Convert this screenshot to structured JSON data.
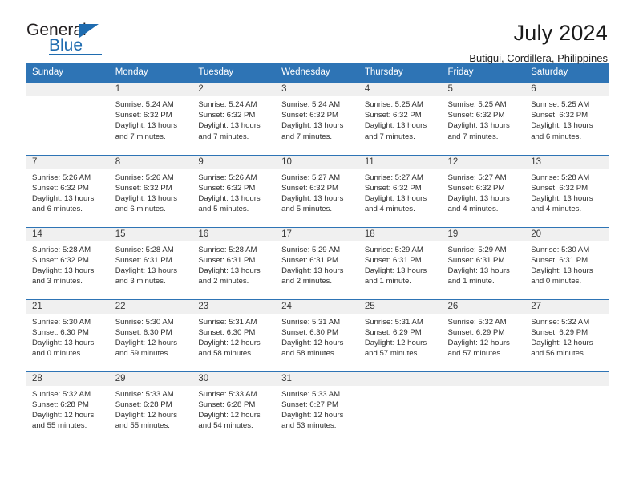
{
  "brand": {
    "name_top": "General",
    "name_bottom": "Blue",
    "accent_color": "#1f6cb0",
    "triangle_icon": "blue-triangle-icon"
  },
  "header": {
    "title": "July 2024",
    "subtitle": "Butigui, Cordillera, Philippines"
  },
  "calendar": {
    "header_bg": "#2e74b5",
    "daynum_bg": "#f0f0f0",
    "weekday_headers": [
      "Sunday",
      "Monday",
      "Tuesday",
      "Wednesday",
      "Thursday",
      "Friday",
      "Saturday"
    ],
    "weeks": [
      [
        {
          "day": "",
          "empty": true,
          "sunrise": "",
          "sunset": "",
          "daylight_line1": "",
          "daylight_line2": ""
        },
        {
          "day": "1",
          "sunrise": "Sunrise: 5:24 AM",
          "sunset": "Sunset: 6:32 PM",
          "daylight_line1": "Daylight: 13 hours",
          "daylight_line2": "and 7 minutes."
        },
        {
          "day": "2",
          "sunrise": "Sunrise: 5:24 AM",
          "sunset": "Sunset: 6:32 PM",
          "daylight_line1": "Daylight: 13 hours",
          "daylight_line2": "and 7 minutes."
        },
        {
          "day": "3",
          "sunrise": "Sunrise: 5:24 AM",
          "sunset": "Sunset: 6:32 PM",
          "daylight_line1": "Daylight: 13 hours",
          "daylight_line2": "and 7 minutes."
        },
        {
          "day": "4",
          "sunrise": "Sunrise: 5:25 AM",
          "sunset": "Sunset: 6:32 PM",
          "daylight_line1": "Daylight: 13 hours",
          "daylight_line2": "and 7 minutes."
        },
        {
          "day": "5",
          "sunrise": "Sunrise: 5:25 AM",
          "sunset": "Sunset: 6:32 PM",
          "daylight_line1": "Daylight: 13 hours",
          "daylight_line2": "and 7 minutes."
        },
        {
          "day": "6",
          "sunrise": "Sunrise: 5:25 AM",
          "sunset": "Sunset: 6:32 PM",
          "daylight_line1": "Daylight: 13 hours",
          "daylight_line2": "and 6 minutes."
        }
      ],
      [
        {
          "day": "7",
          "sunrise": "Sunrise: 5:26 AM",
          "sunset": "Sunset: 6:32 PM",
          "daylight_line1": "Daylight: 13 hours",
          "daylight_line2": "and 6 minutes."
        },
        {
          "day": "8",
          "sunrise": "Sunrise: 5:26 AM",
          "sunset": "Sunset: 6:32 PM",
          "daylight_line1": "Daylight: 13 hours",
          "daylight_line2": "and 6 minutes."
        },
        {
          "day": "9",
          "sunrise": "Sunrise: 5:26 AM",
          "sunset": "Sunset: 6:32 PM",
          "daylight_line1": "Daylight: 13 hours",
          "daylight_line2": "and 5 minutes."
        },
        {
          "day": "10",
          "sunrise": "Sunrise: 5:27 AM",
          "sunset": "Sunset: 6:32 PM",
          "daylight_line1": "Daylight: 13 hours",
          "daylight_line2": "and 5 minutes."
        },
        {
          "day": "11",
          "sunrise": "Sunrise: 5:27 AM",
          "sunset": "Sunset: 6:32 PM",
          "daylight_line1": "Daylight: 13 hours",
          "daylight_line2": "and 4 minutes."
        },
        {
          "day": "12",
          "sunrise": "Sunrise: 5:27 AM",
          "sunset": "Sunset: 6:32 PM",
          "daylight_line1": "Daylight: 13 hours",
          "daylight_line2": "and 4 minutes."
        },
        {
          "day": "13",
          "sunrise": "Sunrise: 5:28 AM",
          "sunset": "Sunset: 6:32 PM",
          "daylight_line1": "Daylight: 13 hours",
          "daylight_line2": "and 4 minutes."
        }
      ],
      [
        {
          "day": "14",
          "sunrise": "Sunrise: 5:28 AM",
          "sunset": "Sunset: 6:32 PM",
          "daylight_line1": "Daylight: 13 hours",
          "daylight_line2": "and 3 minutes."
        },
        {
          "day": "15",
          "sunrise": "Sunrise: 5:28 AM",
          "sunset": "Sunset: 6:31 PM",
          "daylight_line1": "Daylight: 13 hours",
          "daylight_line2": "and 3 minutes."
        },
        {
          "day": "16",
          "sunrise": "Sunrise: 5:28 AM",
          "sunset": "Sunset: 6:31 PM",
          "daylight_line1": "Daylight: 13 hours",
          "daylight_line2": "and 2 minutes."
        },
        {
          "day": "17",
          "sunrise": "Sunrise: 5:29 AM",
          "sunset": "Sunset: 6:31 PM",
          "daylight_line1": "Daylight: 13 hours",
          "daylight_line2": "and 2 minutes."
        },
        {
          "day": "18",
          "sunrise": "Sunrise: 5:29 AM",
          "sunset": "Sunset: 6:31 PM",
          "daylight_line1": "Daylight: 13 hours",
          "daylight_line2": "and 1 minute."
        },
        {
          "day": "19",
          "sunrise": "Sunrise: 5:29 AM",
          "sunset": "Sunset: 6:31 PM",
          "daylight_line1": "Daylight: 13 hours",
          "daylight_line2": "and 1 minute."
        },
        {
          "day": "20",
          "sunrise": "Sunrise: 5:30 AM",
          "sunset": "Sunset: 6:31 PM",
          "daylight_line1": "Daylight: 13 hours",
          "daylight_line2": "and 0 minutes."
        }
      ],
      [
        {
          "day": "21",
          "sunrise": "Sunrise: 5:30 AM",
          "sunset": "Sunset: 6:30 PM",
          "daylight_line1": "Daylight: 13 hours",
          "daylight_line2": "and 0 minutes."
        },
        {
          "day": "22",
          "sunrise": "Sunrise: 5:30 AM",
          "sunset": "Sunset: 6:30 PM",
          "daylight_line1": "Daylight: 12 hours",
          "daylight_line2": "and 59 minutes."
        },
        {
          "day": "23",
          "sunrise": "Sunrise: 5:31 AM",
          "sunset": "Sunset: 6:30 PM",
          "daylight_line1": "Daylight: 12 hours",
          "daylight_line2": "and 58 minutes."
        },
        {
          "day": "24",
          "sunrise": "Sunrise: 5:31 AM",
          "sunset": "Sunset: 6:30 PM",
          "daylight_line1": "Daylight: 12 hours",
          "daylight_line2": "and 58 minutes."
        },
        {
          "day": "25",
          "sunrise": "Sunrise: 5:31 AM",
          "sunset": "Sunset: 6:29 PM",
          "daylight_line1": "Daylight: 12 hours",
          "daylight_line2": "and 57 minutes."
        },
        {
          "day": "26",
          "sunrise": "Sunrise: 5:32 AM",
          "sunset": "Sunset: 6:29 PM",
          "daylight_line1": "Daylight: 12 hours",
          "daylight_line2": "and 57 minutes."
        },
        {
          "day": "27",
          "sunrise": "Sunrise: 5:32 AM",
          "sunset": "Sunset: 6:29 PM",
          "daylight_line1": "Daylight: 12 hours",
          "daylight_line2": "and 56 minutes."
        }
      ],
      [
        {
          "day": "28",
          "sunrise": "Sunrise: 5:32 AM",
          "sunset": "Sunset: 6:28 PM",
          "daylight_line1": "Daylight: 12 hours",
          "daylight_line2": "and 55 minutes."
        },
        {
          "day": "29",
          "sunrise": "Sunrise: 5:33 AM",
          "sunset": "Sunset: 6:28 PM",
          "daylight_line1": "Daylight: 12 hours",
          "daylight_line2": "and 55 minutes."
        },
        {
          "day": "30",
          "sunrise": "Sunrise: 5:33 AM",
          "sunset": "Sunset: 6:28 PM",
          "daylight_line1": "Daylight: 12 hours",
          "daylight_line2": "and 54 minutes."
        },
        {
          "day": "31",
          "sunrise": "Sunrise: 5:33 AM",
          "sunset": "Sunset: 6:27 PM",
          "daylight_line1": "Daylight: 12 hours",
          "daylight_line2": "and 53 minutes."
        },
        {
          "day": "",
          "empty": true,
          "sunrise": "",
          "sunset": "",
          "daylight_line1": "",
          "daylight_line2": ""
        },
        {
          "day": "",
          "empty": true,
          "sunrise": "",
          "sunset": "",
          "daylight_line1": "",
          "daylight_line2": ""
        },
        {
          "day": "",
          "empty": true,
          "sunrise": "",
          "sunset": "",
          "daylight_line1": "",
          "daylight_line2": ""
        }
      ]
    ]
  }
}
